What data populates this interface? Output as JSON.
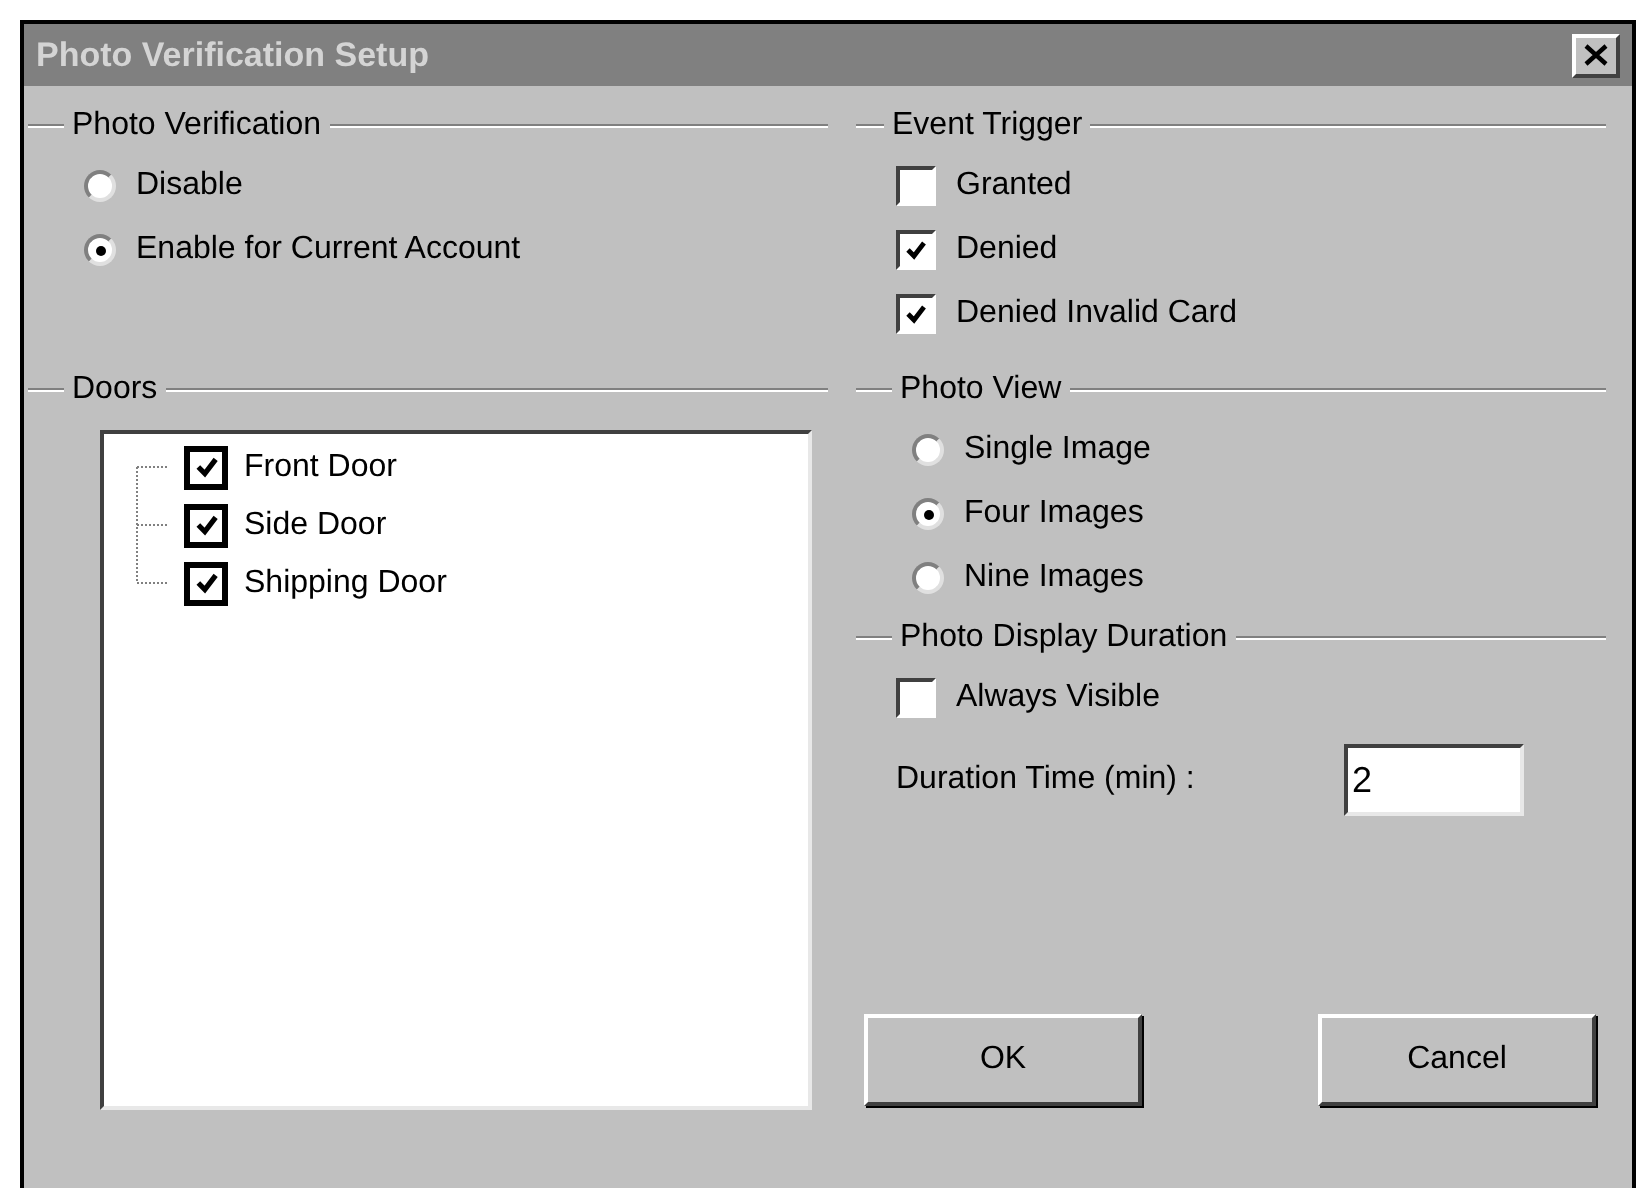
{
  "window": {
    "title": "Photo Verification Setup"
  },
  "photo_verification": {
    "title": "Photo Verification",
    "options": [
      {
        "label": "Disable",
        "selected": false
      },
      {
        "label": "Enable for Current Account",
        "selected": true
      }
    ]
  },
  "doors": {
    "title": "Doors",
    "items": [
      {
        "label": "Front Door",
        "checked": true
      },
      {
        "label": "Side Door",
        "checked": true
      },
      {
        "label": "Shipping Door",
        "checked": true
      }
    ]
  },
  "event_trigger": {
    "title": "Event Trigger",
    "items": [
      {
        "label": "Granted",
        "checked": false
      },
      {
        "label": "Denied",
        "checked": true
      },
      {
        "label": "Denied Invalid Card",
        "checked": true
      }
    ]
  },
  "photo_view": {
    "title": "Photo View",
    "options": [
      {
        "label": "Single Image",
        "selected": false
      },
      {
        "label": "Four Images",
        "selected": true
      },
      {
        "label": "Nine Images",
        "selected": false
      }
    ]
  },
  "photo_display_duration": {
    "title": "Photo Display Duration",
    "always_visible": {
      "label": "Always Visible",
      "checked": false
    },
    "duration": {
      "label": "Duration Time (min) :",
      "value": "2"
    }
  },
  "buttons": [
    "OK",
    "Cancel"
  ]
}
